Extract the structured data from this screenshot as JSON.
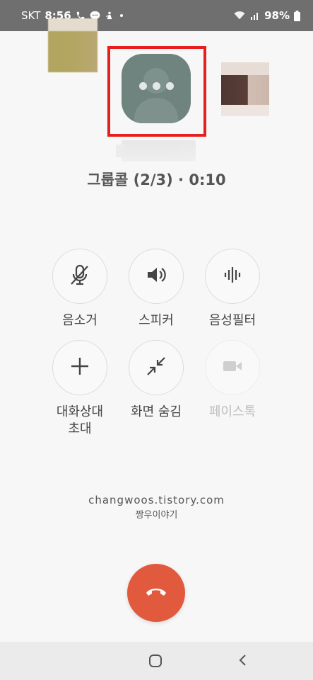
{
  "status_bar": {
    "carrier": "SKT",
    "time": "8:56",
    "battery": "98%",
    "icons_left": [
      "phone-icon",
      "chat-bubble-icon",
      "notification-icon",
      "dot-icon"
    ],
    "icons_right": [
      "wifi-icon",
      "signal-icon",
      "battery-icon"
    ]
  },
  "call": {
    "status": "그룹콜 (2/3) · 0:10"
  },
  "controls": [
    {
      "label": "음소거",
      "icon": "mic-off-icon",
      "enabled": true
    },
    {
      "label": "스피커",
      "icon": "speaker-icon",
      "enabled": true
    },
    {
      "label": "음성필터",
      "icon": "voice-filter-icon",
      "enabled": true
    },
    {
      "label": "대화상대\n초대",
      "icon": "plus-icon",
      "enabled": true
    },
    {
      "label": "화면 숨김",
      "icon": "minimize-icon",
      "enabled": true
    },
    {
      "label": "페이스톡",
      "icon": "video-icon",
      "enabled": false
    }
  ],
  "watermark": {
    "url": "changwoos.tistory.com",
    "nickname": "짱우이야기"
  },
  "colors": {
    "end_call": "#e25a3d",
    "highlight": "#e61e1e",
    "avatar": "#6f837f",
    "status_bar": "#6f6f6f"
  },
  "nav": {
    "icons": [
      "home-icon",
      "back-icon"
    ]
  }
}
